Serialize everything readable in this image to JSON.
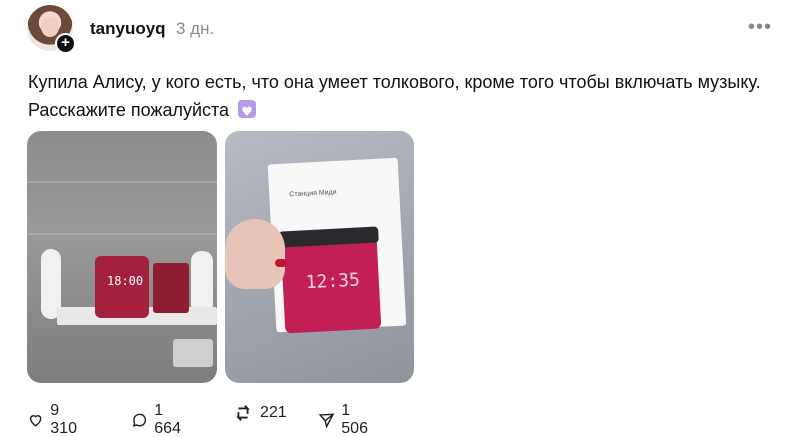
{
  "post": {
    "username": "tanyuoyq",
    "time": "3 дн.",
    "text": "Купила Алису, у кого есть, что она умеет толкового, кроме того чтобы включать музыку. Расскажите пожалуйста",
    "images": [
      {
        "clock": "18:00",
        "box_text": ""
      },
      {
        "clock": "12:35",
        "box_text": "Станция Миди"
      }
    ],
    "stats": {
      "likes": "9 310",
      "comments": "1 664",
      "reposts": "221",
      "shares": "1 506"
    }
  },
  "icons": [
    "avatar",
    "plus-icon",
    "more-icon",
    "heart-emoji-icon",
    "heart-icon",
    "comment-icon",
    "repost-icon",
    "share-icon"
  ]
}
